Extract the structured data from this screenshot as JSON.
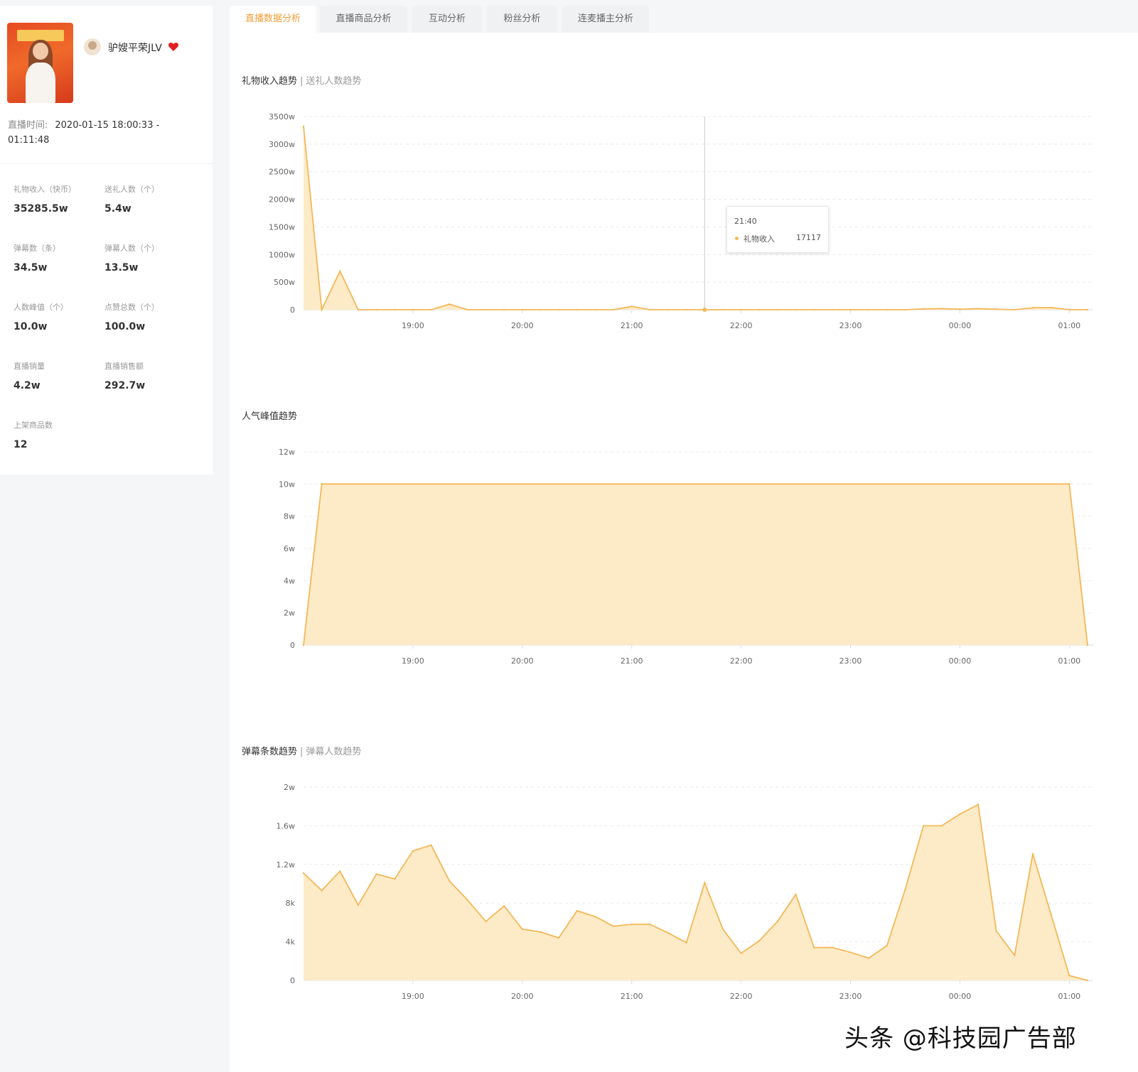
{
  "sidebar": {
    "anchor_name": "驴嫂平荣JLV",
    "live_time_label": "直播时间:",
    "live_time_value": "2020-01-15 18:00:33 - 01:11:48",
    "stats": [
      {
        "label": "礼物收入（快币）",
        "value": "35285.5w"
      },
      {
        "label": "送礼人数（个）",
        "value": "5.4w"
      },
      {
        "label": "弹幕数（条）",
        "value": "34.5w"
      },
      {
        "label": "弹幕人数（个）",
        "value": "13.5w"
      },
      {
        "label": "人数峰值（个）",
        "value": "10.0w"
      },
      {
        "label": "点赞总数（个）",
        "value": "100.0w"
      },
      {
        "label": "直播销量",
        "value": "4.2w"
      },
      {
        "label": "直播销售额",
        "value": "292.7w"
      },
      {
        "label": "上架商品数",
        "value": "12"
      }
    ]
  },
  "tabs": [
    {
      "label": "直播数据分析",
      "active": true
    },
    {
      "label": "直播商品分析",
      "active": false
    },
    {
      "label": "互动分析",
      "active": false
    },
    {
      "label": "粉丝分析",
      "active": false
    },
    {
      "label": "连麦播主分析",
      "active": false
    }
  ],
  "charts": {
    "gift": {
      "title": "礼物收入趋势",
      "alt": "送礼人数趋势"
    },
    "popularity": {
      "title": "人气峰值趋势"
    },
    "danmu": {
      "title": "弹幕条数趋势",
      "alt": "弹幕人数趋势"
    }
  },
  "tooltip": {
    "time": "21:40",
    "series": "礼物收入",
    "value": "17117"
  },
  "watermark": "头条 @科技园广告部",
  "colors": {
    "accent": "#f39c35",
    "line": "#f3b857",
    "fill": "#fdebc8"
  },
  "chart_data": [
    {
      "type": "area",
      "title": "礼物收入趋势",
      "x_ticks": [
        "19:00",
        "20:00",
        "21:00",
        "22:00",
        "23:00",
        "00:00",
        "01:00"
      ],
      "y_ticks": [
        "0",
        "500w",
        "1000w",
        "1500w",
        "2000w",
        "2500w",
        "3000w",
        "3500w"
      ],
      "ylim": [
        0,
        3500
      ],
      "xlim": [
        "18:00",
        "01:10"
      ],
      "x": [
        "18:00",
        "18:10",
        "18:20",
        "18:30",
        "18:40",
        "18:50",
        "19:00",
        "19:10",
        "19:20",
        "19:30",
        "19:40",
        "19:50",
        "20:00",
        "20:10",
        "20:20",
        "20:30",
        "20:40",
        "20:50",
        "21:00",
        "21:10",
        "21:20",
        "21:30",
        "21:40",
        "21:50",
        "22:00",
        "22:10",
        "22:20",
        "22:30",
        "22:40",
        "22:50",
        "23:00",
        "23:10",
        "23:20",
        "23:30",
        "23:40",
        "23:50",
        "00:00",
        "00:10",
        "00:20",
        "00:30",
        "00:40",
        "00:50",
        "01:00",
        "01:10"
      ],
      "values": [
        3320,
        0,
        700,
        0,
        0,
        0,
        0,
        0,
        100,
        0,
        0,
        0,
        0,
        0,
        0,
        0,
        0,
        0,
        60,
        0,
        0,
        0,
        0,
        0,
        0,
        0,
        0,
        0,
        0,
        0,
        0,
        0,
        0,
        0,
        15,
        20,
        10,
        20,
        10,
        0,
        35,
        40,
        0,
        0
      ],
      "unit": "w"
    },
    {
      "type": "area",
      "title": "人气峰值趋势",
      "x_ticks": [
        "19:00",
        "20:00",
        "21:00",
        "22:00",
        "23:00",
        "00:00",
        "01:00"
      ],
      "y_ticks": [
        "0",
        "2w",
        "4w",
        "6w",
        "8w",
        "10w",
        "12w"
      ],
      "ylim": [
        0,
        12
      ],
      "xlim": [
        "18:00",
        "01:10"
      ],
      "x": [
        "18:00",
        "18:10",
        "01:00",
        "01:10"
      ],
      "values": [
        0,
        10,
        10,
        0
      ],
      "unit": "w"
    },
    {
      "type": "area",
      "title": "弹幕条数趋势",
      "x_ticks": [
        "19:00",
        "20:00",
        "21:00",
        "22:00",
        "23:00",
        "00:00",
        "01:00"
      ],
      "y_ticks": [
        "0",
        "4k",
        "8k",
        "1.2w",
        "1.6w",
        "2w"
      ],
      "ylim": [
        0,
        20000
      ],
      "xlim": [
        "18:00",
        "01:10"
      ],
      "x": [
        "18:00",
        "18:10",
        "18:20",
        "18:30",
        "18:40",
        "18:50",
        "19:00",
        "19:10",
        "19:20",
        "19:30",
        "19:40",
        "19:50",
        "20:00",
        "20:10",
        "20:20",
        "20:30",
        "20:40",
        "20:50",
        "21:00",
        "21:10",
        "21:20",
        "21:30",
        "21:40",
        "21:50",
        "22:00",
        "22:10",
        "22:20",
        "22:30",
        "22:40",
        "22:50",
        "23:00",
        "23:10",
        "23:20",
        "23:30",
        "23:40",
        "23:50",
        "00:00",
        "00:10",
        "00:20",
        "00:30",
        "00:40",
        "00:50",
        "01:00",
        "01:10"
      ],
      "values": [
        11100,
        9300,
        11300,
        7800,
        11000,
        10500,
        13400,
        14000,
        10300,
        8300,
        6100,
        7700,
        5300,
        5000,
        4400,
        7200,
        6600,
        5600,
        5800,
        5800,
        4900,
        3900,
        10100,
        5300,
        2800,
        4100,
        6100,
        8900,
        3400,
        3400,
        2900,
        2300,
        3600,
        9400,
        16000,
        16000,
        17200,
        18200,
        5100,
        2600,
        13100,
        6800,
        500,
        0
      ]
    }
  ]
}
